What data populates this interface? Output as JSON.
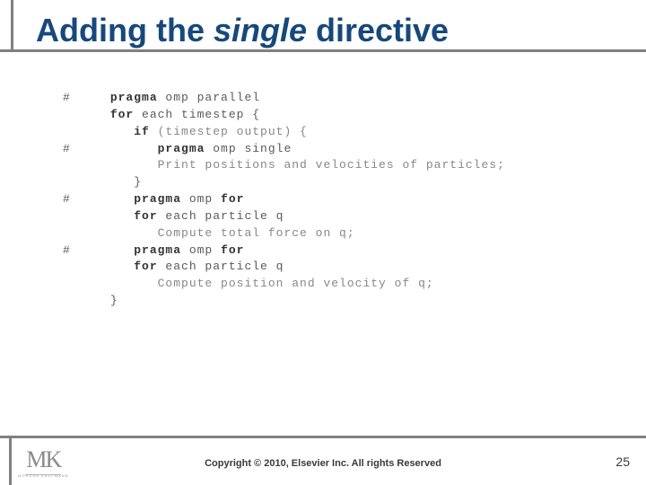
{
  "title": {
    "pre": "Adding the ",
    "italic": "single",
    "post": " directive"
  },
  "code": {
    "h0": "#",
    "l0a": "pragma",
    "l0b": " omp parallel",
    "l1a": "for",
    "l1b": " each timestep {",
    "l2a": "if",
    "l2b": " (timestep output) {",
    "h3": "#",
    "l3a": "pragma",
    "l3b": " omp single",
    "l4": "Print positions and velocities of particles;",
    "l5": "}",
    "h6": "#",
    "l6a": "pragma",
    "l6b": " omp ",
    "l6c": "for",
    "l7a": "for",
    "l7b": " each particle q",
    "l8": "Compute total force on q;",
    "h9": "#",
    "l9a": "pragma",
    "l9b": " omp ",
    "l9c": "for",
    "l10a": "for",
    "l10b": " each particle q",
    "l11": "Compute position and velocity of q;",
    "l12": "}"
  },
  "footer": {
    "logo_main": "MK",
    "logo_sub": "MORGAN KAUFMANN",
    "copyright": "Copyright © 2010, Elsevier Inc. All rights Reserved",
    "page": "25"
  }
}
